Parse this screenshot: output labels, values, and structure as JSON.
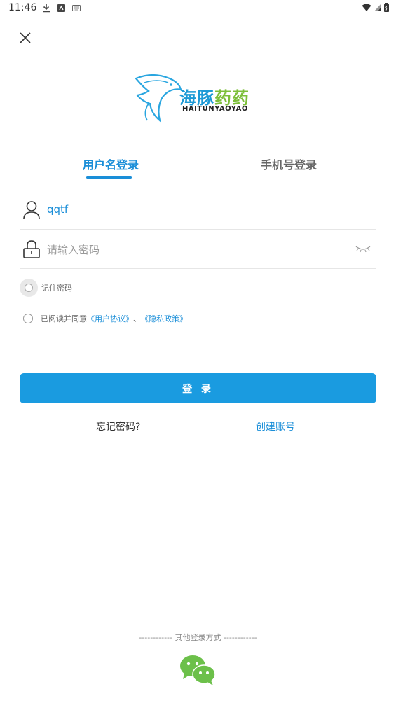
{
  "status_bar": {
    "time": "11:46"
  },
  "logo": {
    "cn_part1": "海豚",
    "cn_part2": "药药",
    "en": "HAITUNYAOYAO"
  },
  "tabs": [
    {
      "label": "用户名登录",
      "active": true
    },
    {
      "label": "手机号登录",
      "active": false
    }
  ],
  "username": {
    "value": "qqtf"
  },
  "password": {
    "placeholder": "请输入密码"
  },
  "remember": {
    "label": "记住密码"
  },
  "agreement": {
    "prefix": "已阅读并同意",
    "user_agreement": "《用户协议》",
    "separator": "、",
    "privacy_policy": "《隐私政策》"
  },
  "login_button": {
    "label": "登 录"
  },
  "links": {
    "forgot": "忘记密码?",
    "create": "创建账号"
  },
  "other_login": {
    "label": "------------ 其他登录方式 ------------"
  },
  "colors": {
    "accent": "#1a9be0",
    "brand_green": "#7cbf3a",
    "wechat": "#6cc04a"
  }
}
